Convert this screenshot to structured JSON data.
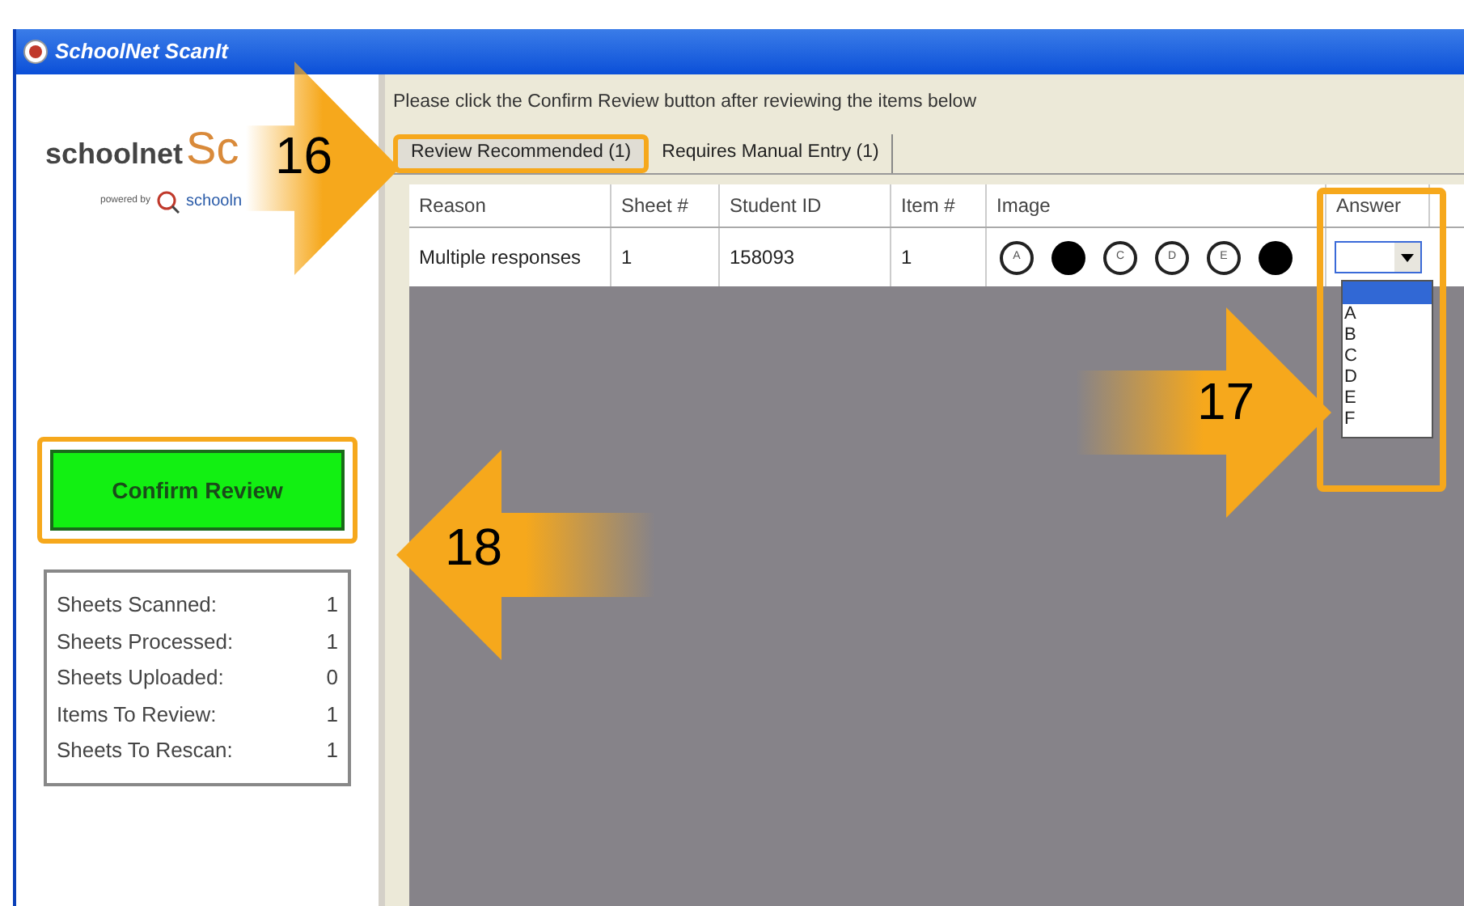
{
  "window": {
    "title": "SchoolNet ScanIt"
  },
  "logo": {
    "brand": "schoolnet",
    "product": "Sc",
    "powered_by": "powered by",
    "powered_brand": "schooln"
  },
  "confirm_button": {
    "label": "Confirm Review",
    "highlighted": true
  },
  "stats": [
    {
      "label": "Sheets Scanned:",
      "value": "1"
    },
    {
      "label": "Sheets Processed:",
      "value": "1"
    },
    {
      "label": "Sheets Uploaded:",
      "value": "0"
    },
    {
      "label": "Items To Review:",
      "value": "1"
    },
    {
      "label": "Sheets To Rescan:",
      "value": "1"
    }
  ],
  "instruction": "Please click the Confirm Review button after reviewing the items below",
  "tabs": [
    {
      "label": "Review Recommended (1)",
      "selected": true,
      "highlighted": true
    },
    {
      "label": "Requires Manual Entry (1)",
      "selected": false,
      "highlighted": false
    }
  ],
  "table": {
    "columns": [
      "Reason",
      "Sheet #",
      "Student ID",
      "Item #",
      "Image",
      "Answer"
    ],
    "rows": [
      {
        "reason": "Multiple responses",
        "sheet": "1",
        "student_id": "158093",
        "item": "1",
        "bubbles": [
          {
            "label": "A",
            "filled": false
          },
          {
            "filled": true
          },
          {
            "label": "C",
            "filled": false
          },
          {
            "label": "D",
            "filled": false
          },
          {
            "label": "E",
            "filled": false
          },
          {
            "filled": true
          }
        ],
        "answer_dropdown": {
          "expanded": true,
          "blank_option_highlighted": true,
          "options": [
            "A",
            "B",
            "C",
            "D",
            "E",
            "F"
          ]
        }
      }
    ]
  },
  "callouts": [
    {
      "number": "16",
      "kind": "right"
    },
    {
      "number": "17",
      "kind": "right"
    },
    {
      "number": "18",
      "kind": "left"
    }
  ]
}
